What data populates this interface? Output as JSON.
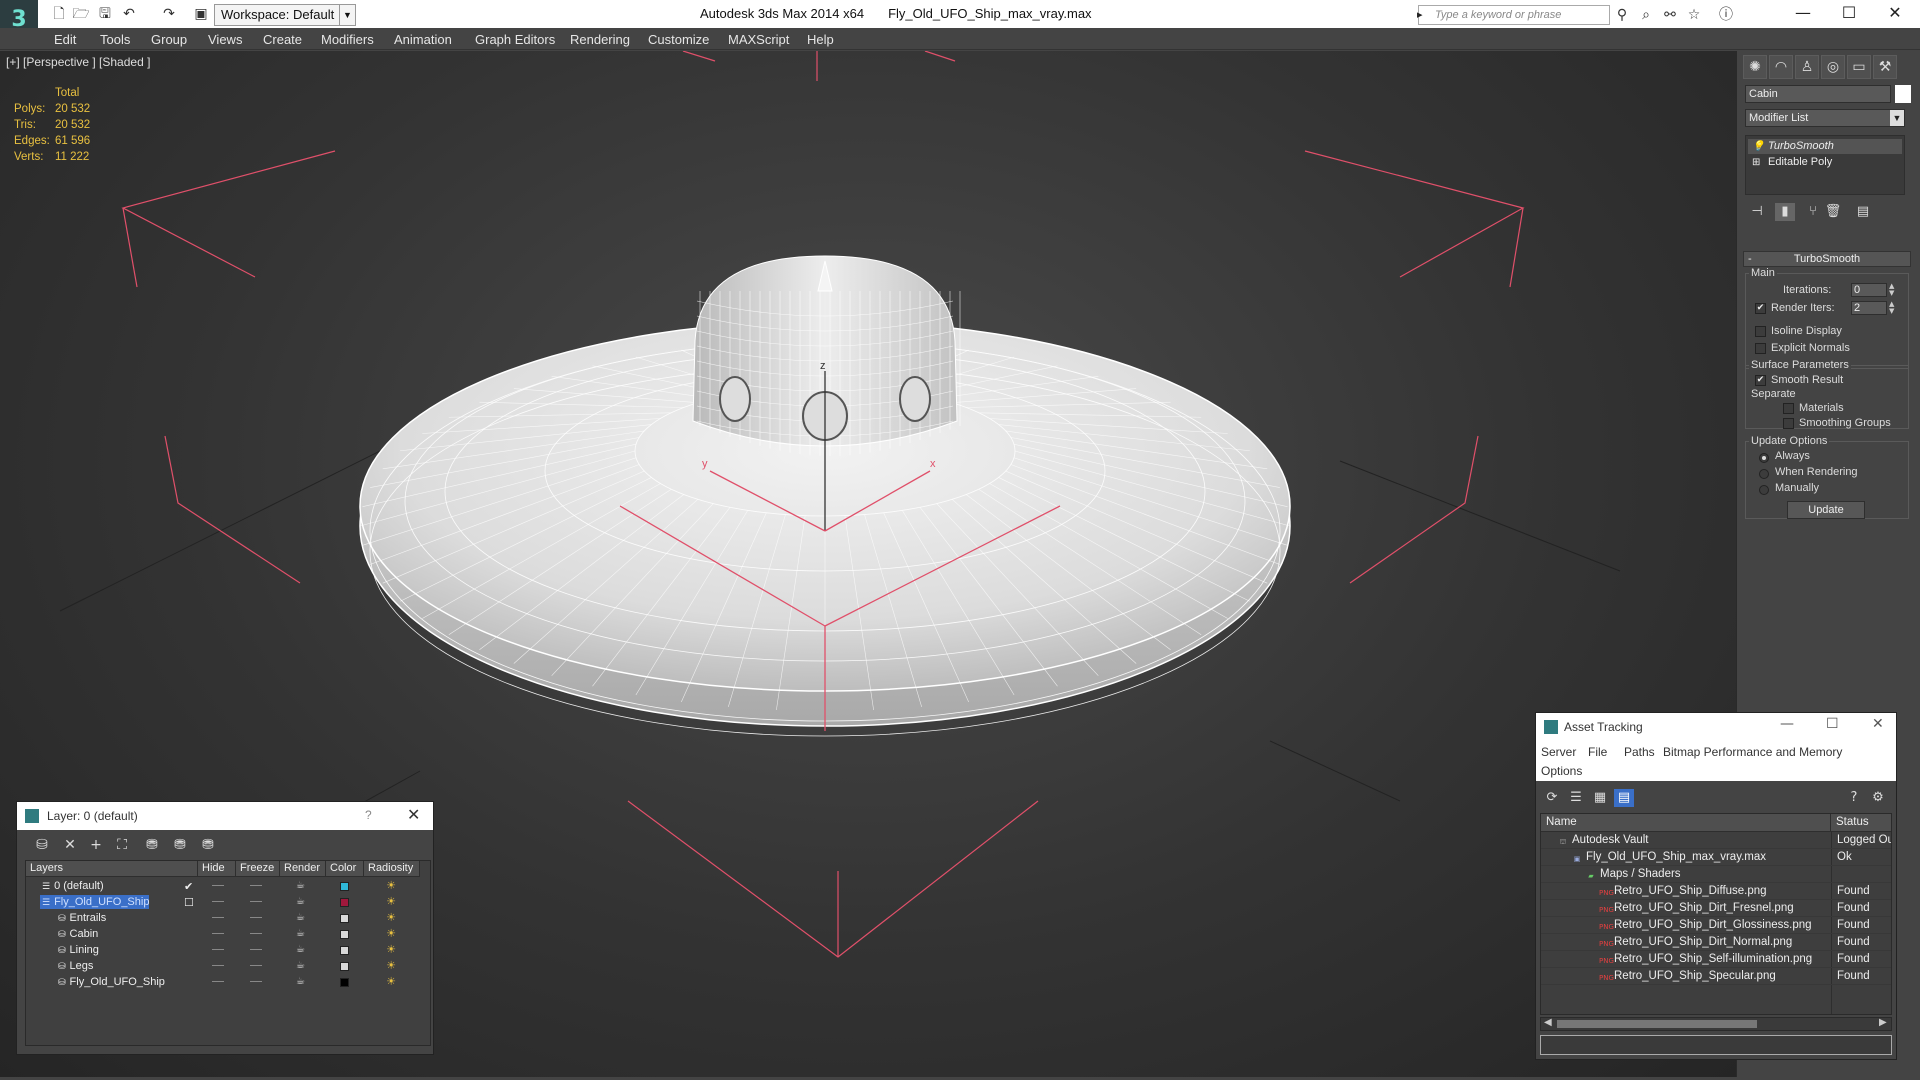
{
  "titlebar": {
    "workspace": "Workspace: Default",
    "app_name": "Autodesk 3ds Max  2014 x64",
    "file_name": "Fly_Old_UFO_Ship_max_vray.max",
    "search_placeholder": "Type a keyword or phrase"
  },
  "menu": [
    "Edit",
    "Tools",
    "Group",
    "Views",
    "Create",
    "Modifiers",
    "Animation",
    "Graph Editors",
    "Rendering",
    "Customize",
    "MAXScript",
    "Help"
  ],
  "viewport": {
    "label": "[+] [Perspective ] [Shaded ]",
    "stats_header": "Total",
    "stats": [
      {
        "label": "Polys:",
        "value": "20 532"
      },
      {
        "label": "Tris:",
        "value": "20 532"
      },
      {
        "label": "Edges:",
        "value": "61 596"
      },
      {
        "label": "Verts:",
        "value": "11 222"
      }
    ],
    "axis_labels": {
      "z": "z",
      "y": "y",
      "x": "x"
    }
  },
  "command_panel": {
    "object_name": "Cabin",
    "modifier_list": "Modifier List",
    "stack": [
      "TurboSmooth",
      "Editable Poly"
    ],
    "rollout_title": "TurboSmooth",
    "main_group": "Main",
    "iterations_label": "Iterations:",
    "iterations_value": "0",
    "render_iters_label": "Render Iters:",
    "render_iters_value": "2",
    "isoline_display": "Isoline Display",
    "explicit_normals": "Explicit Normals",
    "surface_parameters": "Surface Parameters",
    "smooth_result": "Smooth Result",
    "separate": "Separate",
    "materials": "Materials",
    "smoothing_groups": "Smoothing Groups",
    "update_options": "Update Options",
    "always": "Always",
    "when_rendering": "When Rendering",
    "manually": "Manually",
    "update_button": "Update",
    "render_iters_checked": true,
    "smooth_result_checked": true,
    "update_mode": "Always"
  },
  "layer_dialog": {
    "title": "Layer: 0 (default)",
    "help": "?",
    "columns": [
      "Layers",
      "Hide",
      "Freeze",
      "Render",
      "Color",
      "Radiosity"
    ],
    "rows": [
      {
        "name": "0 (default)",
        "indent": 0,
        "color": "#2fb8d8",
        "current": true
      },
      {
        "name": "Fly_Old_UFO_Ship",
        "indent": 0,
        "color": "#a0183c",
        "selected": true
      },
      {
        "name": "Entrails",
        "indent": 1,
        "color": "#d8d8d8"
      },
      {
        "name": "Cabin",
        "indent": 1,
        "color": "#d8d8d8"
      },
      {
        "name": "Lining",
        "indent": 1,
        "color": "#d8d8d8"
      },
      {
        "name": "Legs",
        "indent": 1,
        "color": "#d8d8d8"
      },
      {
        "name": "Fly_Old_UFO_Ship",
        "indent": 1,
        "color": "#000000"
      }
    ]
  },
  "asset_tracking": {
    "title": "Asset Tracking",
    "menu": [
      "Server",
      "File",
      "Paths",
      "Bitmap Performance and Memory",
      "Options"
    ],
    "columns": [
      "Name",
      "Status"
    ],
    "rows": [
      {
        "name": "Autodesk Vault",
        "status": "Logged Ou",
        "indent": 0,
        "icon": "vault-icon"
      },
      {
        "name": "Fly_Old_UFO_Ship_max_vray.max",
        "status": "Ok",
        "indent": 1,
        "icon": "max-file-icon"
      },
      {
        "name": "Maps / Shaders",
        "status": "",
        "indent": 2,
        "icon": "maps-icon"
      },
      {
        "name": "Retro_UFO_Ship_Diffuse.png",
        "status": "Found",
        "indent": 3,
        "icon": "png-icon"
      },
      {
        "name": "Retro_UFO_Ship_Dirt_Fresnel.png",
        "status": "Found",
        "indent": 3,
        "icon": "png-icon"
      },
      {
        "name": "Retro_UFO_Ship_Dirt_Glossiness.png",
        "status": "Found",
        "indent": 3,
        "icon": "png-icon"
      },
      {
        "name": "Retro_UFO_Ship_Dirt_Normal.png",
        "status": "Found",
        "indent": 3,
        "icon": "png-icon"
      },
      {
        "name": "Retro_UFO_Ship_Self-illumination.png",
        "status": "Found",
        "indent": 3,
        "icon": "png-icon"
      },
      {
        "name": "Retro_UFO_Ship_Specular.png",
        "status": "Found",
        "indent": 3,
        "icon": "png-icon"
      }
    ]
  },
  "colors": {
    "accent": "#3a6fc8",
    "stats": "#e8c040",
    "gizmo": "#e0506a"
  }
}
